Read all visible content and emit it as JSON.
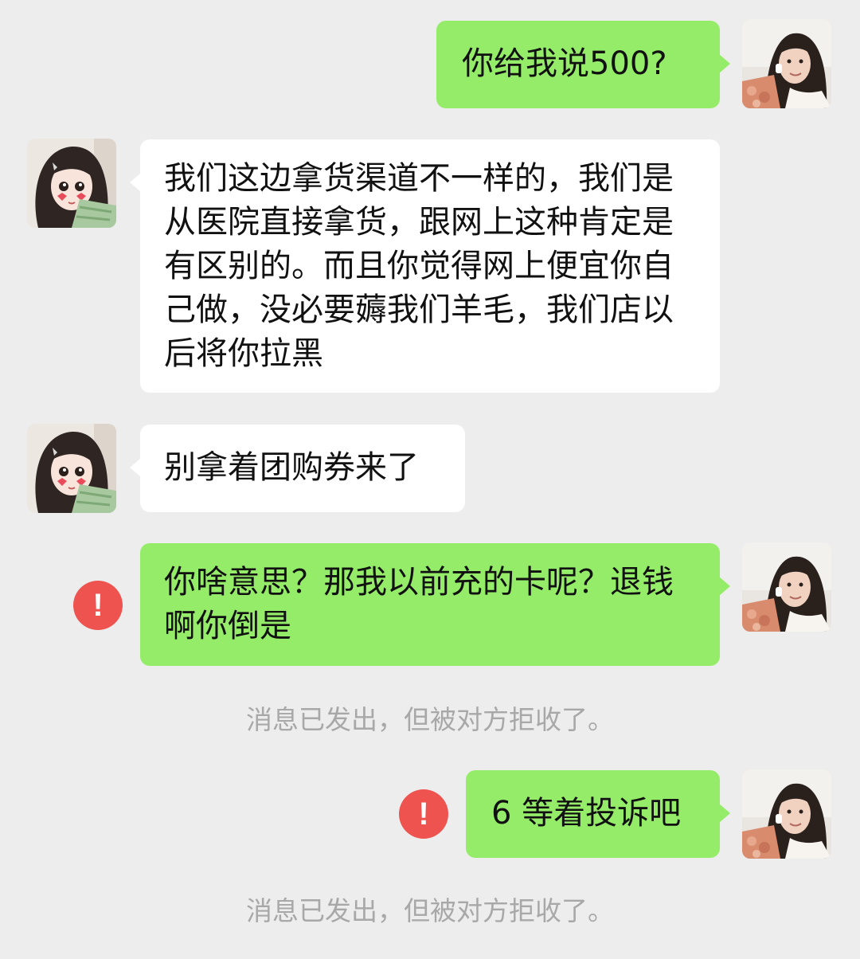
{
  "colors": {
    "background": "#ededed",
    "sent_bubble": "#95ec69",
    "received_bubble": "#ffffff",
    "error_icon": "#ef5350",
    "notice_text": "#a8a8a8"
  },
  "messages": [
    {
      "side": "sent",
      "text": "你给我说500?"
    },
    {
      "side": "received",
      "text": "我们这边拿货渠道不一样的，我们是从医院直接拿货，跟网上这种肯定是有区别的。而且你觉得网上便宜你自己做，没必要薅我们羊毛，我们店以后将你拉黑"
    },
    {
      "side": "received",
      "text": "别拿着团购券来了"
    },
    {
      "side": "sent",
      "text": "你啥意思？那我以前充的卡呢？退钱啊你倒是",
      "status_icon": "error-icon",
      "status_glyph": "!"
    },
    {
      "side": "sent",
      "text": "6 等着投诉吧",
      "status_icon": "error-icon",
      "status_glyph": "!"
    }
  ],
  "notices": [
    "消息已发出，但被对方拒收了。",
    "消息已发出，但被对方拒收了。"
  ],
  "avatars": {
    "self": "self-avatar (girl photo)",
    "contact": "contact-avatar (cartoon girl with money)"
  }
}
